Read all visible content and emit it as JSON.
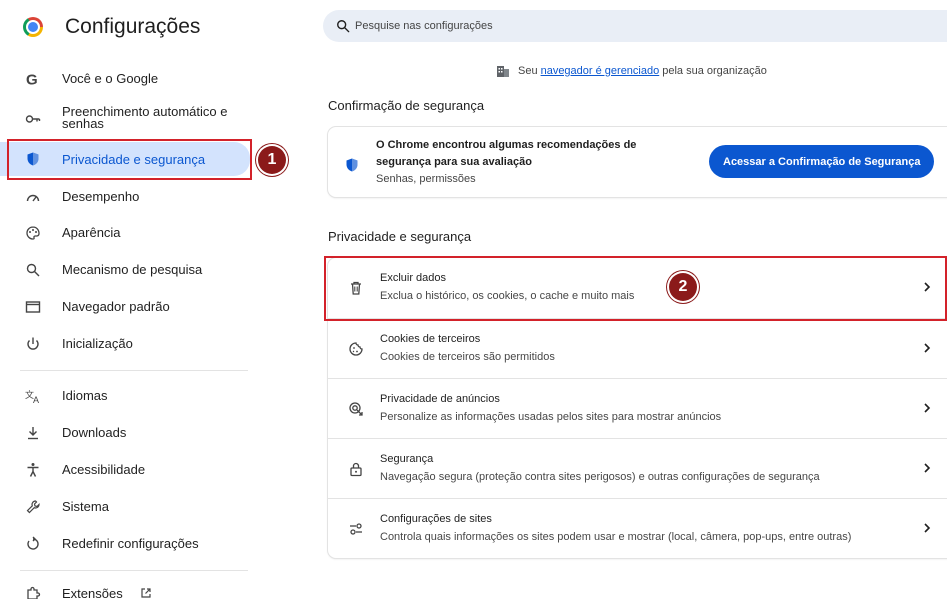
{
  "header": {
    "app_title": "Configurações",
    "search_placeholder": "Pesquise nas configurações"
  },
  "sidebar": {
    "items": [
      {
        "label": "Você e o Google",
        "icon": "google-icon"
      },
      {
        "label": "Preenchimento automático e senhas",
        "icon": "key-icon"
      },
      {
        "label": "Privacidade e segurança",
        "icon": "shield-icon",
        "active": true
      },
      {
        "label": "Desempenho",
        "icon": "speedometer-icon"
      },
      {
        "label": "Aparência",
        "icon": "palette-icon"
      },
      {
        "label": "Mecanismo de pesquisa",
        "icon": "search-icon"
      },
      {
        "label": "Navegador padrão",
        "icon": "browser-window-icon"
      },
      {
        "label": "Inicialização",
        "icon": "power-icon"
      },
      {
        "label": "Idiomas",
        "icon": "translate-icon"
      },
      {
        "label": "Downloads",
        "icon": "download-icon"
      },
      {
        "label": "Acessibilidade",
        "icon": "accessibility-icon"
      },
      {
        "label": "Sistema",
        "icon": "wrench-icon"
      },
      {
        "label": "Redefinir configurações",
        "icon": "reset-icon"
      },
      {
        "label": "Extensões",
        "icon": "puzzle-icon"
      }
    ]
  },
  "managed": {
    "prefix": "Seu",
    "link": "navegador é gerenciado",
    "suffix": "pela sua organização"
  },
  "safety_check": {
    "section_title": "Confirmação de segurança",
    "line1": "O Chrome encontrou algumas recomendações de segurança para sua avaliação",
    "line2": "Senhas, permissões",
    "button_label": "Acessar a Confirmação de Segurança"
  },
  "privacy": {
    "section_title": "Privacidade e segurança",
    "rows": [
      {
        "title": "Excluir dados",
        "subtitle": "Exclua o histórico, os cookies, o cache e muito mais",
        "icon": "trash-icon"
      },
      {
        "title": "Cookies de terceiros",
        "subtitle": "Cookies de terceiros são permitidos",
        "icon": "cookie-icon"
      },
      {
        "title": "Privacidade de anúncios",
        "subtitle": "Personalize as informações usadas pelos sites para mostrar anúncios",
        "icon": "ad-privacy-icon"
      },
      {
        "title": "Segurança",
        "subtitle": "Navegação segura (proteção contra sites perigosos) e outras configurações de segurança",
        "icon": "lock-icon"
      },
      {
        "title": "Configurações de sites",
        "subtitle": "Controla quais informações os sites podem usar e mostrar (local, câmera, pop-ups, entre outras)",
        "icon": "sliders-icon"
      }
    ]
  },
  "annotations": {
    "badge1": "1",
    "badge2": "2"
  },
  "colors": {
    "accent": "#0b57d0",
    "annotation": "#d3222a",
    "active_bg": "#d3e3fd"
  }
}
